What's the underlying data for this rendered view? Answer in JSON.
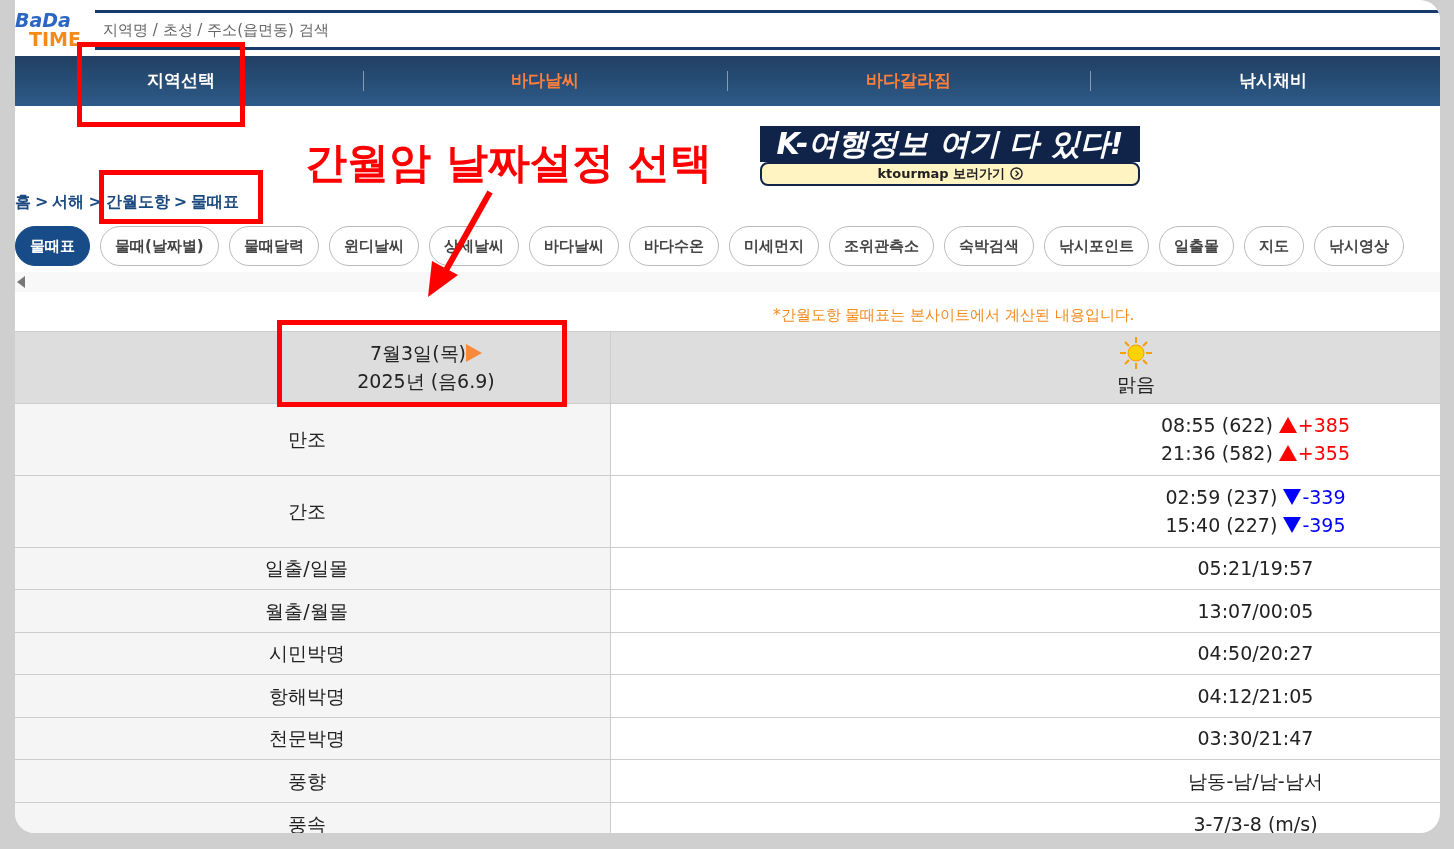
{
  "logo": {
    "line_1": "BaDa",
    "line_2": "TIME"
  },
  "search": {
    "placeholder": "지역명 / 초성 / 주소(읍면동) 검색"
  },
  "nav": [
    {
      "label": "지역선택",
      "highlight": false
    },
    {
      "label": "바다날씨",
      "highlight": true
    },
    {
      "label": "바다갈라짐",
      "highlight": true
    },
    {
      "label": "낚시채비",
      "highlight": false
    }
  ],
  "banner": {
    "title": "K-여행정보 여기 다 있다!",
    "link": "ktourmap 보러가기"
  },
  "breadcrumb": [
    {
      "kind": "link",
      "text": "홈"
    },
    {
      "kind": "separator",
      "text": ">"
    },
    {
      "kind": "link",
      "text": "서해"
    },
    {
      "kind": "separator",
      "text": ">"
    },
    {
      "kind": "link",
      "text": "간월도항"
    },
    {
      "kind": "separator",
      "text": ">"
    },
    {
      "kind": "link",
      "text": "물때표"
    }
  ],
  "pills": [
    {
      "label": "물때표",
      "selected": true
    },
    {
      "label": "물때(날짜별)",
      "selected": false
    },
    {
      "label": "물때달력",
      "selected": false
    },
    {
      "label": "윈디날씨",
      "selected": false
    },
    {
      "label": "상세날씨",
      "selected": false
    },
    {
      "label": "바다날씨",
      "selected": false
    },
    {
      "label": "바다수온",
      "selected": false
    },
    {
      "label": "미세먼지",
      "selected": false
    },
    {
      "label": "조위관측소",
      "selected": false
    },
    {
      "label": "숙박검색",
      "selected": false
    },
    {
      "label": "낚시포인트",
      "selected": false
    },
    {
      "label": "일출몰",
      "selected": false
    },
    {
      "label": "지도",
      "selected": false
    },
    {
      "label": "낚시영상",
      "selected": false
    }
  ],
  "note": "*간월도항 물때표는 본사이트에서 계산된 내용입니다.",
  "table": {
    "date": "7월3일(목)",
    "year": "2025년 (음6.9)",
    "weather": "맑음",
    "rows": [
      {
        "label": "만조",
        "kind": "tide",
        "entries": [
          {
            "time": "08:55 (622)",
            "rising": true,
            "change": "+385"
          },
          {
            "time": "21:36 (582)",
            "rising": true,
            "change": "+355"
          }
        ]
      },
      {
        "label": "간조",
        "kind": "tide",
        "entries": [
          {
            "time": "02:59 (237)",
            "rising": false,
            "change": "-339"
          },
          {
            "time": "15:40 (227)",
            "rising": false,
            "change": "-395"
          }
        ]
      },
      {
        "label": "일출/일몰",
        "kind": "text",
        "value": "05:21/19:57"
      },
      {
        "label": "월출/월몰",
        "kind": "text",
        "value": "13:07/00:05"
      },
      {
        "label": "시민박명",
        "kind": "text",
        "value": "04:50/20:27"
      },
      {
        "label": "항해박명",
        "kind": "text",
        "value": "04:12/21:05"
      },
      {
        "label": "천문박명",
        "kind": "text",
        "value": "03:30/21:47"
      },
      {
        "label": "풍향",
        "kind": "text",
        "value": "남동-남/남-남서"
      },
      {
        "label": "풍속",
        "kind": "text",
        "value": "3-7/3-8 (m/s)"
      }
    ]
  },
  "annotation": {
    "text": "간월암 날짜설정 선택"
  }
}
